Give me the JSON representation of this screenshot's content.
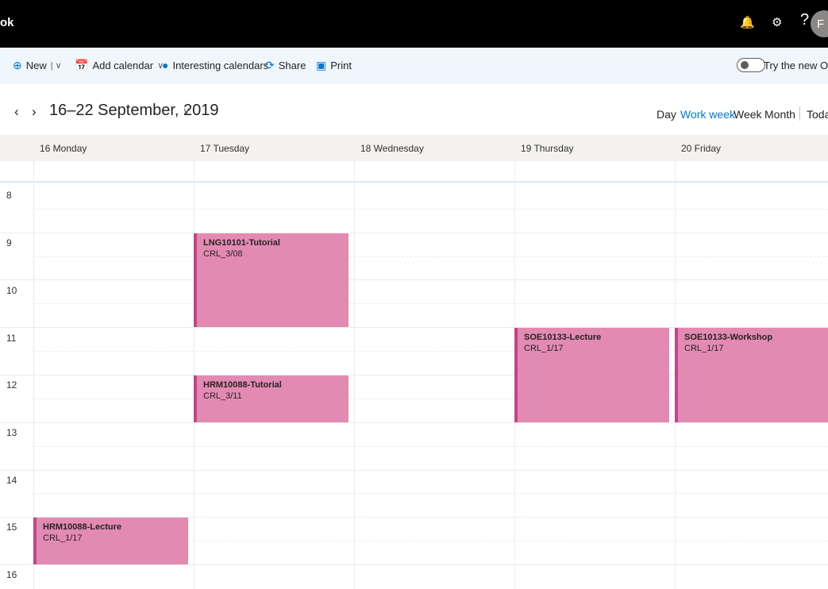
{
  "app": {
    "title": "ok"
  },
  "topbar": {
    "help_label": "?",
    "avatar_initial": "F"
  },
  "toolbar": {
    "new_label": "New",
    "add_calendar_label": "Add calendar",
    "interesting_label": "Interesting calendars",
    "share_label": "Share",
    "print_label": "Print",
    "try_new_label": "Try the new Outlo"
  },
  "nav": {
    "date_range": "16–22 September, 2019"
  },
  "views": {
    "day": "Day",
    "work_week": "Work week",
    "week": "Week",
    "month": "Month",
    "today": "Today"
  },
  "days": [
    "16 Monday",
    "17 Tuesday",
    "18 Wednesday",
    "19 Thursday",
    "20 Friday"
  ],
  "hours": [
    "8",
    "9",
    "10",
    "11",
    "12",
    "13",
    "14",
    "15",
    "16"
  ],
  "events": [
    {
      "title": "LNG10101-Tutorial",
      "location": "CRL_3/08",
      "day": "17 Tuesday",
      "start": "9:00",
      "end": "11:00"
    },
    {
      "title": "HRM10088-Tutorial",
      "location": "CRL_3/11",
      "day": "17 Tuesday",
      "start": "12:00",
      "end": "13:00"
    },
    {
      "title": "SOE10133-Lecture",
      "location": "CRL_1/17",
      "day": "19 Thursday",
      "start": "11:00",
      "end": "13:00"
    },
    {
      "title": "SOE10133-Workshop",
      "location": "CRL_1/17",
      "day": "20 Friday",
      "start": "11:00",
      "end": "13:00"
    },
    {
      "title": "HRM10088-Lecture",
      "location": "CRL_1/17",
      "day": "16 Monday",
      "start": "15:00",
      "end": "16:00"
    }
  ],
  "colors": {
    "event_fill": "#e38ab3",
    "event_border": "#c2448b",
    "accent": "#0078d4"
  }
}
